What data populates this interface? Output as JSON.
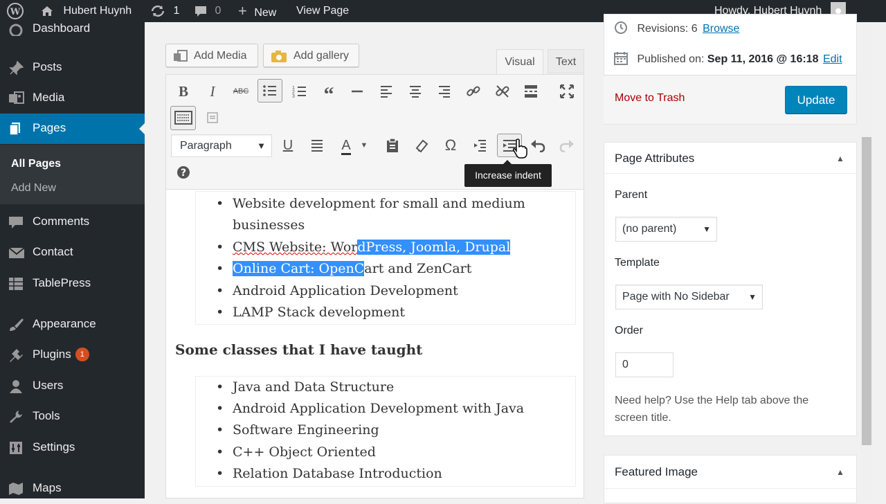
{
  "admin_bar": {
    "site_name": "Hubert Huynh",
    "updates_count": "1",
    "comments_count": "0",
    "new_label": "New",
    "view_page": "View Page",
    "howdy": "Howdy, Hubert Huynh"
  },
  "sidebar": {
    "items": [
      {
        "label": "Dashboard",
        "icon": "dashboard-icon"
      },
      {
        "label": "Posts",
        "icon": "pin-icon"
      },
      {
        "label": "Media",
        "icon": "media-icon"
      },
      {
        "label": "Pages",
        "icon": "pages-icon"
      },
      {
        "label": "Comments",
        "icon": "comment-icon"
      },
      {
        "label": "Contact",
        "icon": "mail-icon"
      },
      {
        "label": "TablePress",
        "icon": "table-icon"
      },
      {
        "label": "Appearance",
        "icon": "brush-icon"
      },
      {
        "label": "Plugins",
        "icon": "plugin-icon",
        "badge": "1"
      },
      {
        "label": "Users",
        "icon": "users-icon"
      },
      {
        "label": "Tools",
        "icon": "wrench-icon"
      },
      {
        "label": "Settings",
        "icon": "settings-icon"
      },
      {
        "label": "Maps",
        "icon": "map-icon"
      }
    ],
    "submenu": [
      "All Pages",
      "Add New"
    ]
  },
  "editor": {
    "add_media": "Add Media",
    "add_gallery": "Add gallery",
    "tab_visual": "Visual",
    "tab_text": "Text",
    "format_select": "Paragraph",
    "tooltip": "Increase indent",
    "list1": [
      "Website development for small  and medium",
      "businesses",
      "CMS Website: Wor",
      "dPress, Joomla, Drupal",
      "Online Cart: OpenC",
      "art and ZenCart",
      "Android Application Development",
      "LAMP Stack development"
    ],
    "heading": "Some classes that I have taught",
    "list2": [
      "Java and Data Structure",
      "Android Application Development with Java",
      "Software Engineering",
      "C++ Object Oriented",
      "Relation Database Introduction"
    ]
  },
  "publish": {
    "revisions_label": "Revisions: 6",
    "browse": "Browse",
    "published_label": "Published on:",
    "published_value": "Sep 11, 2016 @ 16:18",
    "edit": "Edit",
    "trash": "Move to Trash",
    "update": "Update"
  },
  "page_attributes": {
    "title": "Page Attributes",
    "parent_label": "Parent",
    "parent_value": "(no parent)",
    "template_label": "Template",
    "template_value": "Page with No Sidebar",
    "order_label": "Order",
    "order_value": "0",
    "help_line1": "Need help? Use the Help tab above the",
    "help_line2": "screen title."
  },
  "featured_image": {
    "title": "Featured Image"
  },
  "colors": {
    "admin_dark": "#23282d",
    "accent_blue": "#0073aa",
    "selection": "#3390ff",
    "trash_red": "#a00"
  }
}
